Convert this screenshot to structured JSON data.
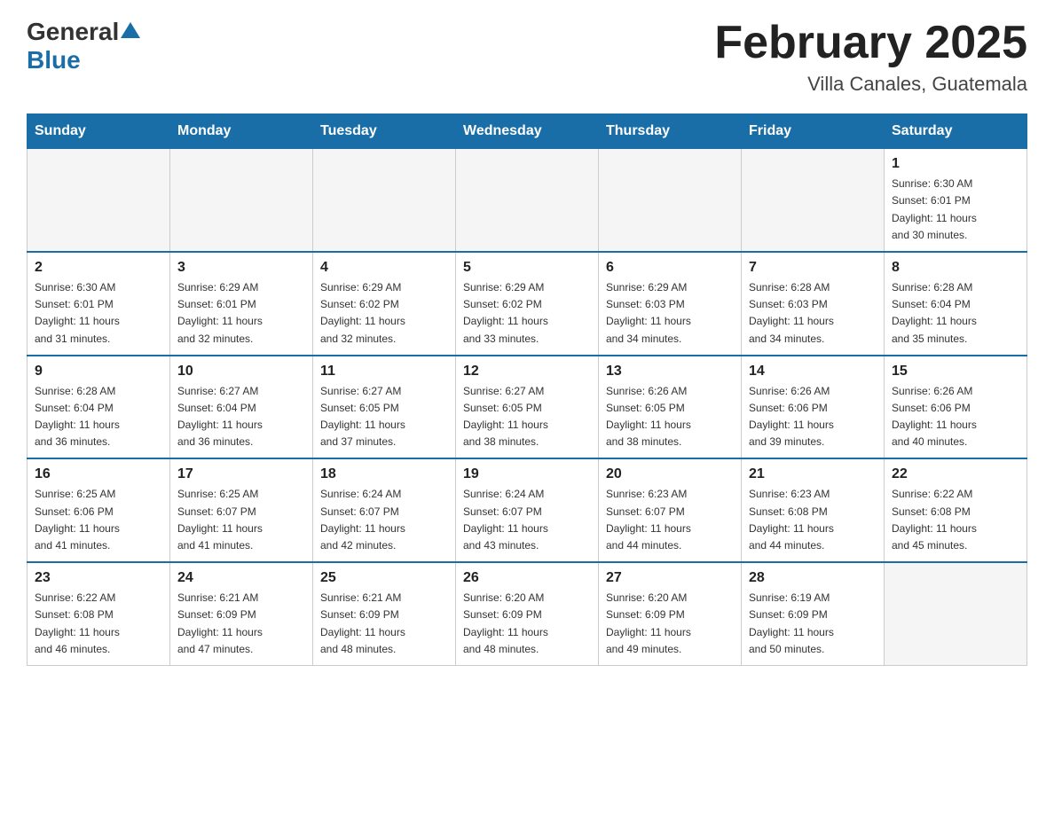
{
  "header": {
    "logo": {
      "general": "General",
      "triangle": "▲",
      "blue": "Blue"
    },
    "title": "February 2025",
    "location": "Villa Canales, Guatemala"
  },
  "weekdays": [
    "Sunday",
    "Monday",
    "Tuesday",
    "Wednesday",
    "Thursday",
    "Friday",
    "Saturday"
  ],
  "weeks": [
    [
      {
        "day": "",
        "info": ""
      },
      {
        "day": "",
        "info": ""
      },
      {
        "day": "",
        "info": ""
      },
      {
        "day": "",
        "info": ""
      },
      {
        "day": "",
        "info": ""
      },
      {
        "day": "",
        "info": ""
      },
      {
        "day": "1",
        "info": "Sunrise: 6:30 AM\nSunset: 6:01 PM\nDaylight: 11 hours\nand 30 minutes."
      }
    ],
    [
      {
        "day": "2",
        "info": "Sunrise: 6:30 AM\nSunset: 6:01 PM\nDaylight: 11 hours\nand 31 minutes."
      },
      {
        "day": "3",
        "info": "Sunrise: 6:29 AM\nSunset: 6:01 PM\nDaylight: 11 hours\nand 32 minutes."
      },
      {
        "day": "4",
        "info": "Sunrise: 6:29 AM\nSunset: 6:02 PM\nDaylight: 11 hours\nand 32 minutes."
      },
      {
        "day": "5",
        "info": "Sunrise: 6:29 AM\nSunset: 6:02 PM\nDaylight: 11 hours\nand 33 minutes."
      },
      {
        "day": "6",
        "info": "Sunrise: 6:29 AM\nSunset: 6:03 PM\nDaylight: 11 hours\nand 34 minutes."
      },
      {
        "day": "7",
        "info": "Sunrise: 6:28 AM\nSunset: 6:03 PM\nDaylight: 11 hours\nand 34 minutes."
      },
      {
        "day": "8",
        "info": "Sunrise: 6:28 AM\nSunset: 6:04 PM\nDaylight: 11 hours\nand 35 minutes."
      }
    ],
    [
      {
        "day": "9",
        "info": "Sunrise: 6:28 AM\nSunset: 6:04 PM\nDaylight: 11 hours\nand 36 minutes."
      },
      {
        "day": "10",
        "info": "Sunrise: 6:27 AM\nSunset: 6:04 PM\nDaylight: 11 hours\nand 36 minutes."
      },
      {
        "day": "11",
        "info": "Sunrise: 6:27 AM\nSunset: 6:05 PM\nDaylight: 11 hours\nand 37 minutes."
      },
      {
        "day": "12",
        "info": "Sunrise: 6:27 AM\nSunset: 6:05 PM\nDaylight: 11 hours\nand 38 minutes."
      },
      {
        "day": "13",
        "info": "Sunrise: 6:26 AM\nSunset: 6:05 PM\nDaylight: 11 hours\nand 38 minutes."
      },
      {
        "day": "14",
        "info": "Sunrise: 6:26 AM\nSunset: 6:06 PM\nDaylight: 11 hours\nand 39 minutes."
      },
      {
        "day": "15",
        "info": "Sunrise: 6:26 AM\nSunset: 6:06 PM\nDaylight: 11 hours\nand 40 minutes."
      }
    ],
    [
      {
        "day": "16",
        "info": "Sunrise: 6:25 AM\nSunset: 6:06 PM\nDaylight: 11 hours\nand 41 minutes."
      },
      {
        "day": "17",
        "info": "Sunrise: 6:25 AM\nSunset: 6:07 PM\nDaylight: 11 hours\nand 41 minutes."
      },
      {
        "day": "18",
        "info": "Sunrise: 6:24 AM\nSunset: 6:07 PM\nDaylight: 11 hours\nand 42 minutes."
      },
      {
        "day": "19",
        "info": "Sunrise: 6:24 AM\nSunset: 6:07 PM\nDaylight: 11 hours\nand 43 minutes."
      },
      {
        "day": "20",
        "info": "Sunrise: 6:23 AM\nSunset: 6:07 PM\nDaylight: 11 hours\nand 44 minutes."
      },
      {
        "day": "21",
        "info": "Sunrise: 6:23 AM\nSunset: 6:08 PM\nDaylight: 11 hours\nand 44 minutes."
      },
      {
        "day": "22",
        "info": "Sunrise: 6:22 AM\nSunset: 6:08 PM\nDaylight: 11 hours\nand 45 minutes."
      }
    ],
    [
      {
        "day": "23",
        "info": "Sunrise: 6:22 AM\nSunset: 6:08 PM\nDaylight: 11 hours\nand 46 minutes."
      },
      {
        "day": "24",
        "info": "Sunrise: 6:21 AM\nSunset: 6:09 PM\nDaylight: 11 hours\nand 47 minutes."
      },
      {
        "day": "25",
        "info": "Sunrise: 6:21 AM\nSunset: 6:09 PM\nDaylight: 11 hours\nand 48 minutes."
      },
      {
        "day": "26",
        "info": "Sunrise: 6:20 AM\nSunset: 6:09 PM\nDaylight: 11 hours\nand 48 minutes."
      },
      {
        "day": "27",
        "info": "Sunrise: 6:20 AM\nSunset: 6:09 PM\nDaylight: 11 hours\nand 49 minutes."
      },
      {
        "day": "28",
        "info": "Sunrise: 6:19 AM\nSunset: 6:09 PM\nDaylight: 11 hours\nand 50 minutes."
      },
      {
        "day": "",
        "info": ""
      }
    ]
  ]
}
